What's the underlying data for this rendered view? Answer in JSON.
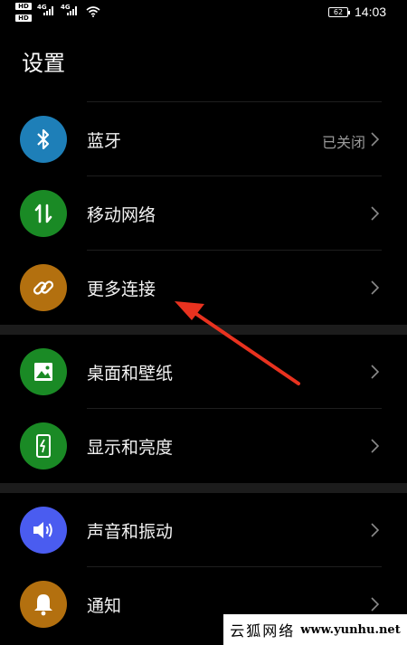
{
  "status_bar": {
    "hd1": "HD",
    "hd2": "HD",
    "net1": "4G",
    "net2": "4G",
    "battery": "62",
    "time": "14:03"
  },
  "title": "设置",
  "groups": [
    {
      "items": [
        {
          "label": "蓝牙",
          "value": "已关闭",
          "icon": "bluetooth-icon",
          "color": "#1e7fb8"
        },
        {
          "label": "移动网络",
          "value": "",
          "icon": "mobile-data-icon",
          "color": "#1a8a25"
        },
        {
          "label": "更多连接",
          "value": "",
          "icon": "link-icon",
          "color": "#b3700f"
        }
      ]
    },
    {
      "items": [
        {
          "label": "桌面和壁纸",
          "value": "",
          "icon": "wallpaper-icon",
          "color": "#1a8a25"
        },
        {
          "label": "显示和亮度",
          "value": "",
          "icon": "display-brightness-icon",
          "color": "#1a8a25"
        }
      ]
    },
    {
      "items": [
        {
          "label": "声音和振动",
          "value": "",
          "icon": "speaker-icon",
          "color": "#4a5cf0"
        },
        {
          "label": "通知",
          "value": "",
          "icon": "bell-icon",
          "color": "#b3700f"
        }
      ]
    }
  ],
  "annotation": {
    "color": "#e8321f"
  },
  "watermark": {
    "text_cn": "云狐网络",
    "url": "www.yunhu.net"
  }
}
